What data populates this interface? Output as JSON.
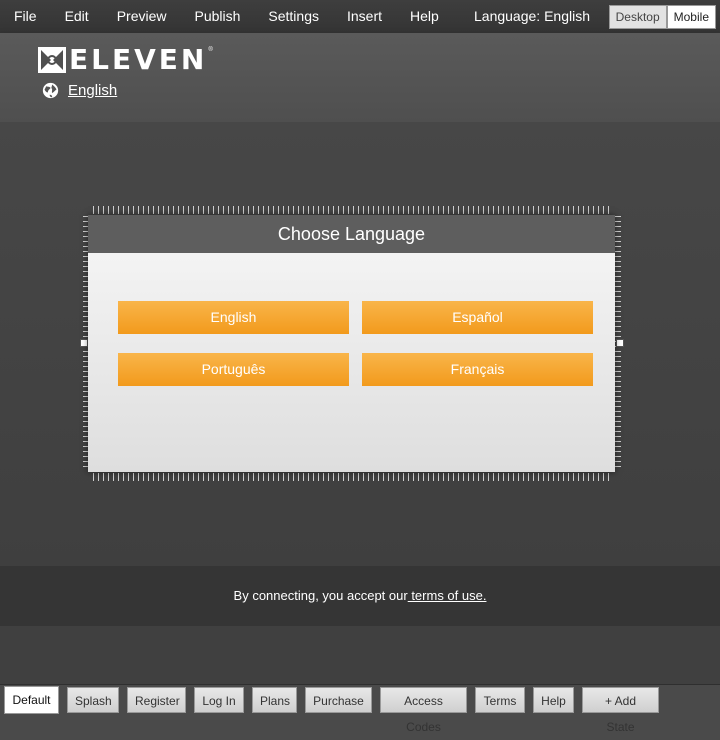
{
  "menubar": {
    "items": [
      "File",
      "Edit",
      "Preview",
      "Publish",
      "Settings",
      "Insert",
      "Help"
    ],
    "language_label": "Language: English",
    "view_desktop": "Desktop",
    "view_mobile": "Mobile"
  },
  "header": {
    "logo_text": "ELEVEN",
    "logo_reg": "®",
    "language_link": "English"
  },
  "dialog": {
    "title": "Choose Language",
    "buttons": [
      "English",
      "Español",
      "Português",
      "Français"
    ]
  },
  "footer": {
    "text": "By connecting, you accept our",
    "link": " terms of use."
  },
  "states": {
    "tabs": [
      "Default",
      "Splash",
      "Register",
      "Log In",
      "Plans",
      "Purchase",
      "Access Codes",
      "Terms",
      "Help"
    ],
    "add_label": "+ Add State",
    "active": "Default"
  },
  "colors": {
    "button_orange": "#f5a530",
    "title_bar": "#5e5e5e",
    "menubar": "#3a3a3a"
  }
}
